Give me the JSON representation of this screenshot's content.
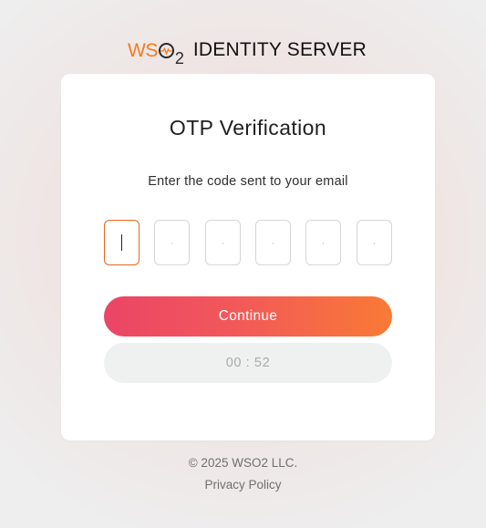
{
  "brand": {
    "logo_prefix": "WS",
    "logo_suffix": "2",
    "product_name": "IDENTITY SERVER"
  },
  "card": {
    "title": "OTP Verification",
    "subtitle": "Enter the code sent to your email",
    "otp_placeholder": "·",
    "continue_label": "Continue",
    "timer_text": "00 : 52"
  },
  "footer": {
    "copyright": "© 2025 WSO2 LLC.",
    "privacy_link": "Privacy Policy"
  },
  "colors": {
    "brand_orange": "#f47b20",
    "button_gradient_start": "#ea4566",
    "button_gradient_end": "#f97a35",
    "active_border": "#e8661e"
  },
  "icons": {
    "logo": "wso2-logo-icon"
  }
}
